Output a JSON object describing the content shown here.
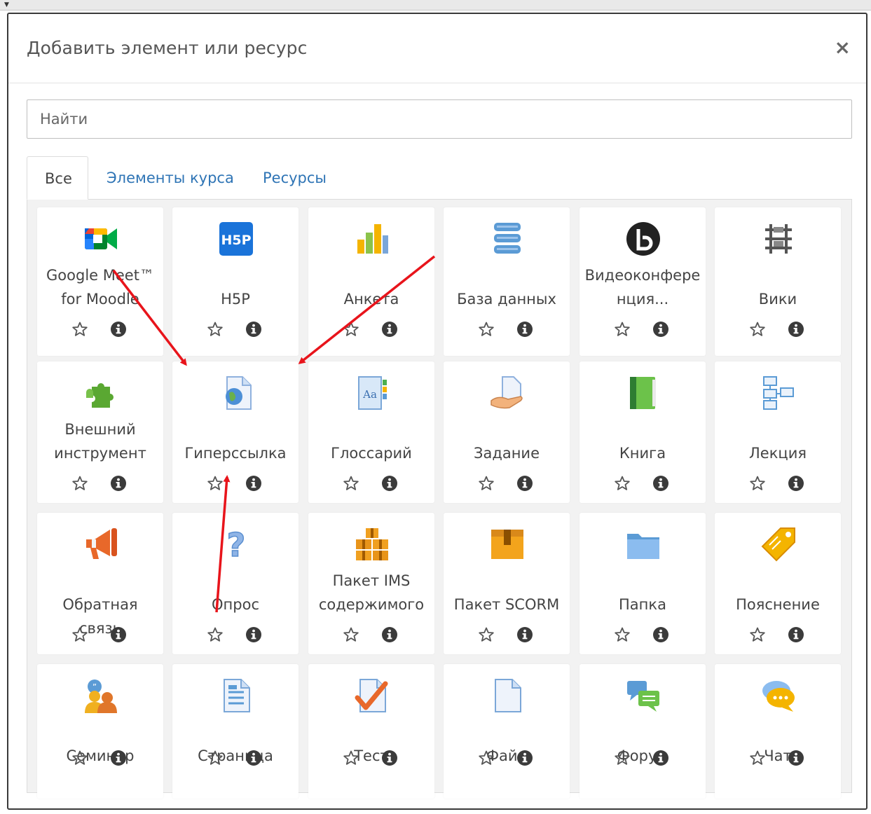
{
  "dialog": {
    "title": "Добавить элемент или ресурс",
    "close_label": "×",
    "search_placeholder": "Найти"
  },
  "tabs": [
    {
      "label": "Все",
      "active": true
    },
    {
      "label": "Элементы курса",
      "active": false
    },
    {
      "label": "Ресурсы",
      "active": false
    }
  ],
  "items": [
    {
      "label": "Google Meet™\nfor Moodle",
      "icon": "google-meet-icon"
    },
    {
      "label": "H5P",
      "icon": "h5p-icon"
    },
    {
      "label": "Анкета",
      "icon": "survey-icon"
    },
    {
      "label": "База данных",
      "icon": "database-icon"
    },
    {
      "label": "Видеоконфере\nнция...",
      "icon": "bigbluebutton-icon"
    },
    {
      "label": "Вики",
      "icon": "wiki-icon"
    },
    {
      "label": "Внешний\nинструмент",
      "icon": "external-tool-icon"
    },
    {
      "label": "Гиперссылка",
      "icon": "url-icon"
    },
    {
      "label": "Глоссарий",
      "icon": "glossary-icon"
    },
    {
      "label": "Задание",
      "icon": "assignment-icon"
    },
    {
      "label": "Книга",
      "icon": "book-icon"
    },
    {
      "label": "Лекция",
      "icon": "lesson-icon"
    },
    {
      "label": "Обратная связь",
      "icon": "feedback-icon"
    },
    {
      "label": "Опрос",
      "icon": "choice-icon"
    },
    {
      "label": "Пакет IMS\nсодержимого",
      "icon": "ims-package-icon"
    },
    {
      "label": "Пакет SCORM",
      "icon": "scorm-package-icon"
    },
    {
      "label": "Папка",
      "icon": "folder-icon"
    },
    {
      "label": "Пояснение",
      "icon": "label-icon"
    },
    {
      "label": "Семинар",
      "icon": "workshop-icon"
    },
    {
      "label": "Страница",
      "icon": "page-icon"
    },
    {
      "label": "Тест",
      "icon": "quiz-icon"
    },
    {
      "label": "Файл",
      "icon": "file-icon"
    },
    {
      "label": "Форум",
      "icon": "forum-icon"
    },
    {
      "label": "Чат",
      "icon": "chat-icon"
    }
  ],
  "colors": {
    "link": "#2e74b5",
    "annotation_arrow": "#e8141b",
    "card_bg": "#ffffff",
    "panel_bg": "#f2f2f2"
  }
}
